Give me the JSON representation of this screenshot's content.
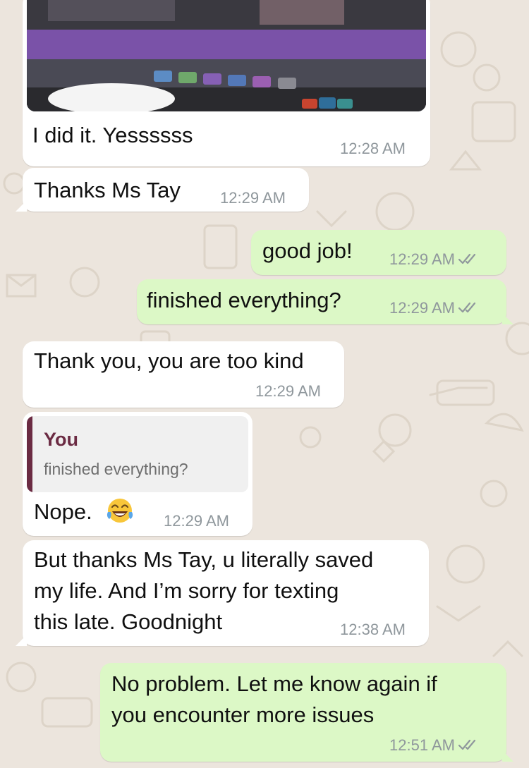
{
  "chat": {
    "messages": [
      {
        "text": "I did it. Yessssss",
        "time": "12:28 AM"
      },
      {
        "text": "Thanks Ms Tay",
        "time": "12:29 AM"
      },
      {
        "text": "good job!",
        "time": "12:29 AM"
      },
      {
        "text": "finished everything?",
        "time": "12:29 AM"
      },
      {
        "text": "Thank you, you are too kind",
        "time": "12:29 AM"
      },
      {
        "reply_author": "You",
        "reply_text": "finished everything?",
        "text": "Nope.",
        "emoji": "tears-of-joy-emoji",
        "time": "12:29 AM"
      },
      {
        "line1": "But thanks Ms Tay, u literally saved",
        "line2": "my life. And I’m sorry for texting",
        "line3": "this late. Goodnight",
        "time": "12:38 AM"
      },
      {
        "line1": "No problem. Let me know again if",
        "line2": "you encounter more issues",
        "time": "12:51 AM"
      }
    ]
  },
  "icons": {
    "read_receipt": "double-check-icon"
  },
  "colors": {
    "background": "#ece5dd",
    "incoming_bubble": "#ffffff",
    "outgoing_bubble": "#dcf8c6",
    "read_ticks": "#8f979c",
    "reply_accent": "#6b2b43"
  }
}
